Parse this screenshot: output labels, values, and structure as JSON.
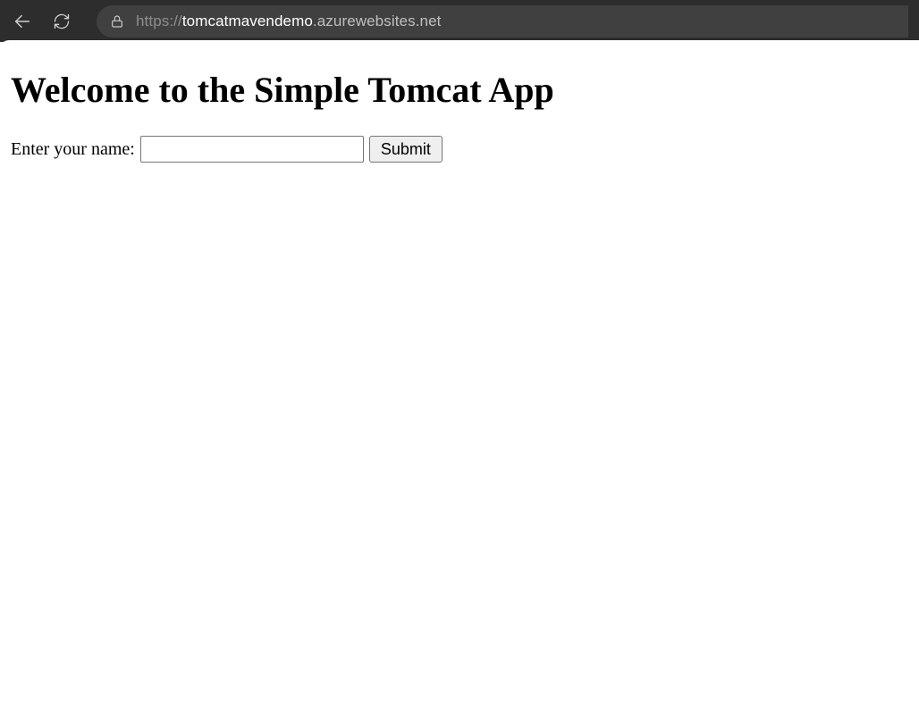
{
  "browser": {
    "url_scheme": "https://",
    "url_host": "tomcatmavendemo",
    "url_rest": ".azurewebsites.net"
  },
  "page": {
    "heading": "Welcome to the Simple Tomcat App",
    "form": {
      "label": "Enter your name:",
      "input_value": "",
      "submit_label": "Submit"
    }
  }
}
